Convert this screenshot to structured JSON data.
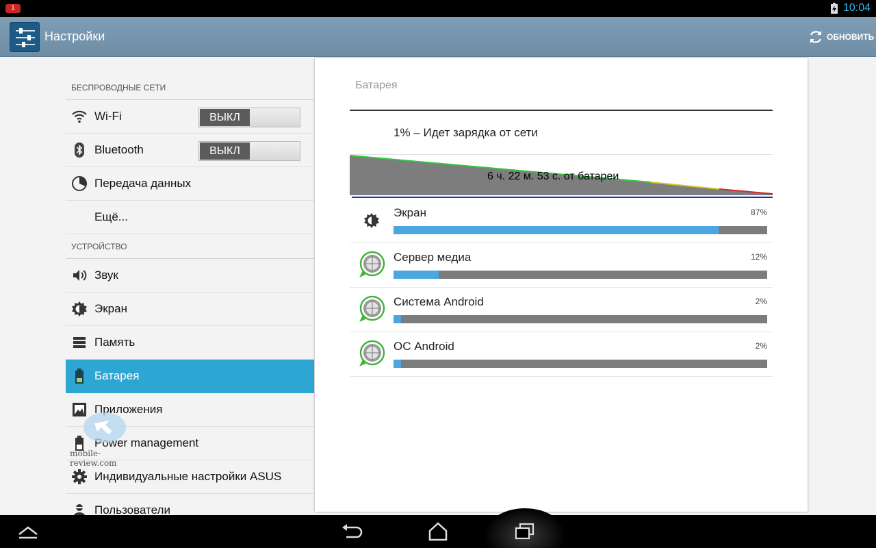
{
  "status_bar": {
    "notification_badge": "1",
    "clock": "10:04",
    "accent_color": "#33b5e5"
  },
  "action_bar": {
    "app_icon": "settings-sliders-icon",
    "title": "Настройки",
    "refresh_icon": "refresh-icon",
    "refresh_label": "ОБНОВИТЬ"
  },
  "sidebar": {
    "sections": [
      {
        "header": "БЕСПРОВОДНЫЕ СЕТИ",
        "items": [
          {
            "label": "Wi-Fi",
            "icon": "wifi-icon",
            "toggle": "ВЫКЛ"
          },
          {
            "label": "Bluetooth",
            "icon": "bluetooth-icon",
            "toggle": "ВЫКЛ"
          },
          {
            "label": "Передача данных",
            "icon": "data-usage-icon"
          },
          {
            "label": "Ещё..."
          }
        ]
      },
      {
        "header": "УСТРОЙСТВО",
        "items": [
          {
            "label": "Звук",
            "icon": "speaker-icon"
          },
          {
            "label": "Экран",
            "icon": "brightness-icon"
          },
          {
            "label": "Память",
            "icon": "storage-icon"
          },
          {
            "label": "Батарея",
            "icon": "battery-icon",
            "selected": true
          },
          {
            "label": "Приложения",
            "icon": "apps-icon"
          },
          {
            "label": "Power management",
            "icon": "power-management-icon"
          },
          {
            "label": "Индивидуальные настройки ASUS",
            "icon": "gear-icon"
          },
          {
            "label": "Пользователи",
            "icon": "user-icon"
          }
        ]
      }
    ],
    "selected_color": "#2ea6d4"
  },
  "watermark": {
    "text": "mobile-review.com"
  },
  "battery": {
    "title": "Батарея",
    "charge_status": "1% – Идет зарядка от сети",
    "graph_label": "6 ч. 22 м. 53 с. от батареи",
    "usage": [
      {
        "name": "Экран",
        "percent_label": "87%",
        "fraction": 0.87,
        "icon": "brightness-icon"
      },
      {
        "name": "Сервер медиа",
        "percent_label": "12%",
        "fraction": 0.12,
        "icon": "android-system-icon"
      },
      {
        "name": "Система Android",
        "percent_label": "2%",
        "fraction": 0.02,
        "icon": "android-system-icon"
      },
      {
        "name": "ОС Android",
        "percent_label": "2%",
        "fraction": 0.02,
        "icon": "android-system-icon"
      }
    ],
    "bar_fill_color": "#4da6e0",
    "bar_track_color": "#7c7c7c"
  },
  "nav_bar": {
    "buttons": [
      "hide-bar-icon",
      "back-icon",
      "home-icon",
      "recent-apps-icon"
    ]
  }
}
